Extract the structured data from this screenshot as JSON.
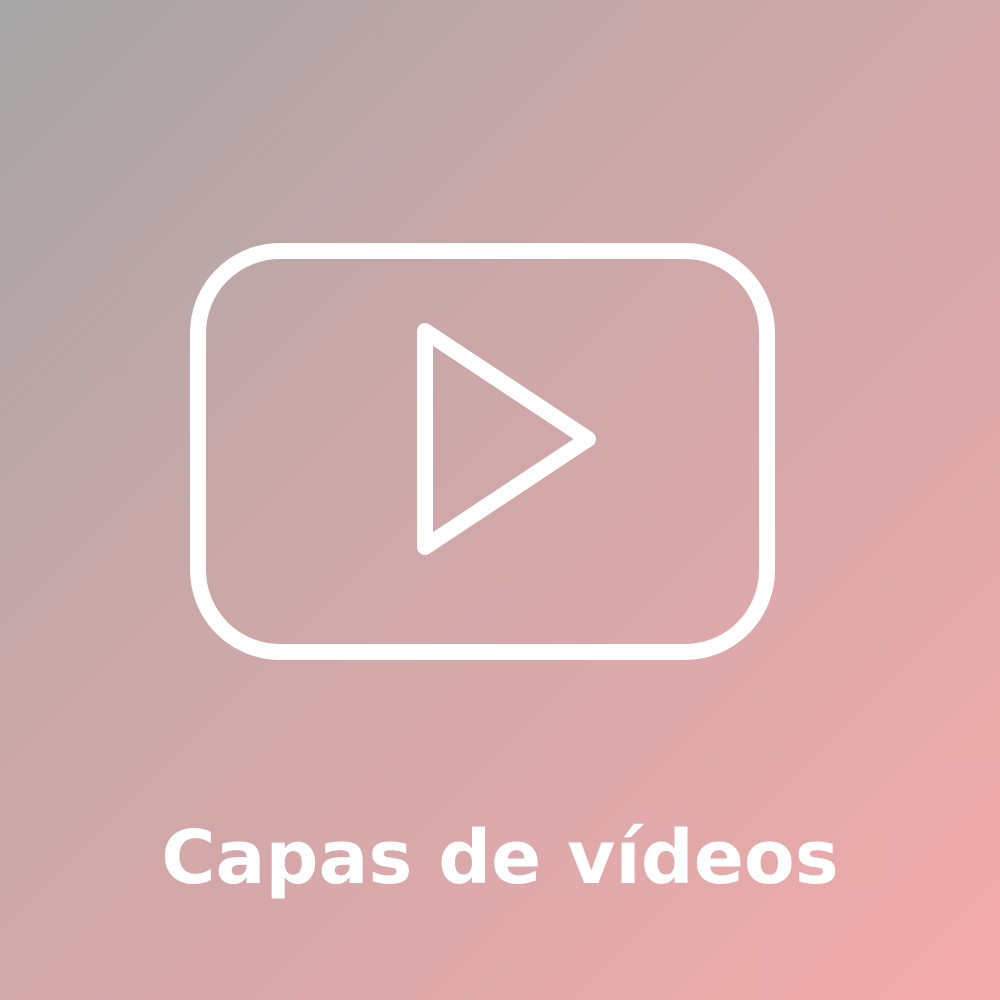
{
  "tile": {
    "icon": "play-video-icon",
    "caption": "Capas de vídeos",
    "icon_color": "#ffffff",
    "gradient": [
      "#a6a6a6",
      "#c7a7a8",
      "#dba9aa",
      "#f3aaab"
    ]
  }
}
